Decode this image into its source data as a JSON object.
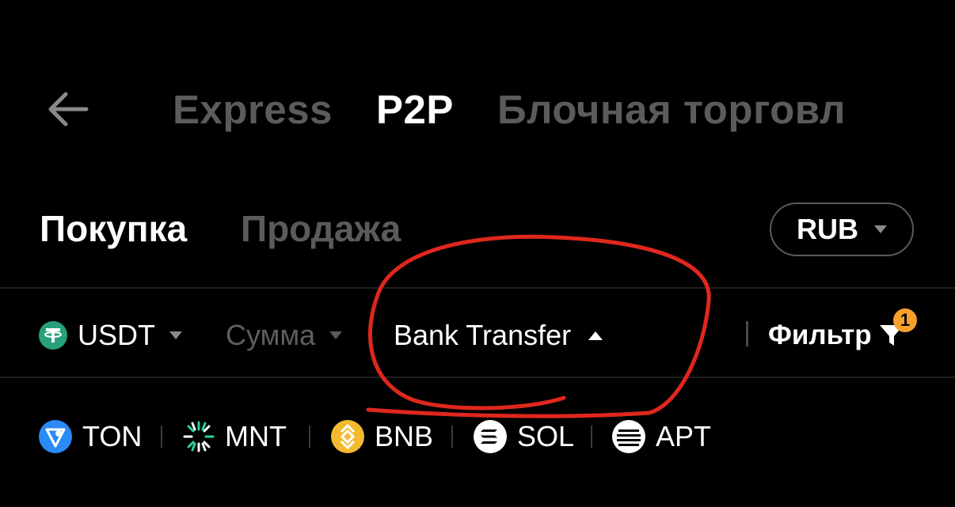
{
  "header": {
    "back_icon": "arrow-left-icon",
    "tabs": [
      {
        "label": "Express",
        "active": false
      },
      {
        "label": "P2P",
        "active": true
      },
      {
        "label": "Блочная торговл",
        "active": false
      }
    ]
  },
  "trade_side": {
    "buy_label": "Покупка",
    "sell_label": "Продажа",
    "active": "buy"
  },
  "currency_selector": {
    "value": "RUB"
  },
  "filters": {
    "asset": {
      "label": "USDT",
      "icon": "tether-icon"
    },
    "amount": {
      "label": "Сумма"
    },
    "payment": {
      "label": "Bank Transfer"
    },
    "filter": {
      "label": "Фильтр",
      "icon": "funnel-icon",
      "badge": "1"
    }
  },
  "coins": [
    {
      "name": "TON",
      "icon": "ton-icon"
    },
    {
      "name": "MNT",
      "icon": "mantle-icon"
    },
    {
      "name": "BNB",
      "icon": "bnb-icon"
    },
    {
      "name": "SOL",
      "icon": "solana-icon"
    },
    {
      "name": "APT",
      "icon": "aptos-icon"
    }
  ],
  "colors": {
    "background": "#000000",
    "inactive_text": "#5b5b5b",
    "badge": "#f7a12c",
    "annotation": "#e0271d"
  }
}
